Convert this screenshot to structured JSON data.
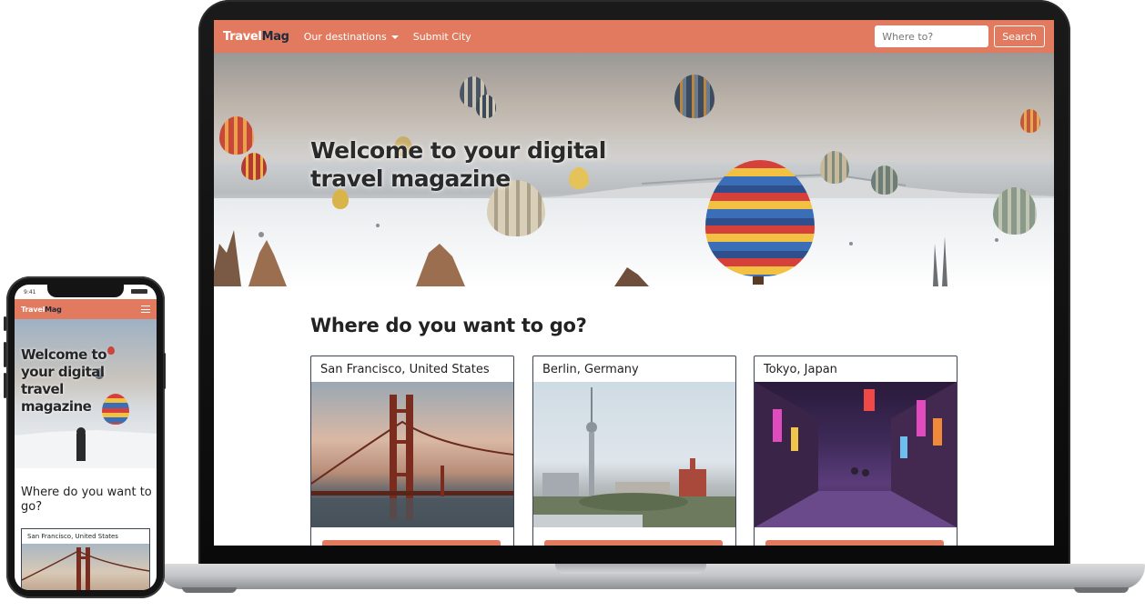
{
  "laptop": {
    "navbar": {
      "brand_a": "Travel",
      "brand_b": "Mag",
      "dropdown_label": "Our destinations",
      "submit_link": "Submit City",
      "search_placeholder": "Where to?",
      "search_button": "Search"
    },
    "hero": {
      "title": "Welcome to your digital travel magazine"
    },
    "section_title": "Where do you want to go?",
    "cards": [
      {
        "title": "San Francisco, United States"
      },
      {
        "title": "Berlin, Germany"
      },
      {
        "title": "Tokyo, Japan"
      }
    ]
  },
  "phone": {
    "status_time": "9:41",
    "brand_a": "Travel",
    "brand_b": "Mag",
    "hero_title": "Welcome to your digital travel magazine",
    "section_title": "Where do you want to go?",
    "card_title": "San Francisco, United States"
  },
  "colors": {
    "accent": "#e27a60",
    "dark": "#1f2a3c",
    "card_border": "#3b4458"
  }
}
